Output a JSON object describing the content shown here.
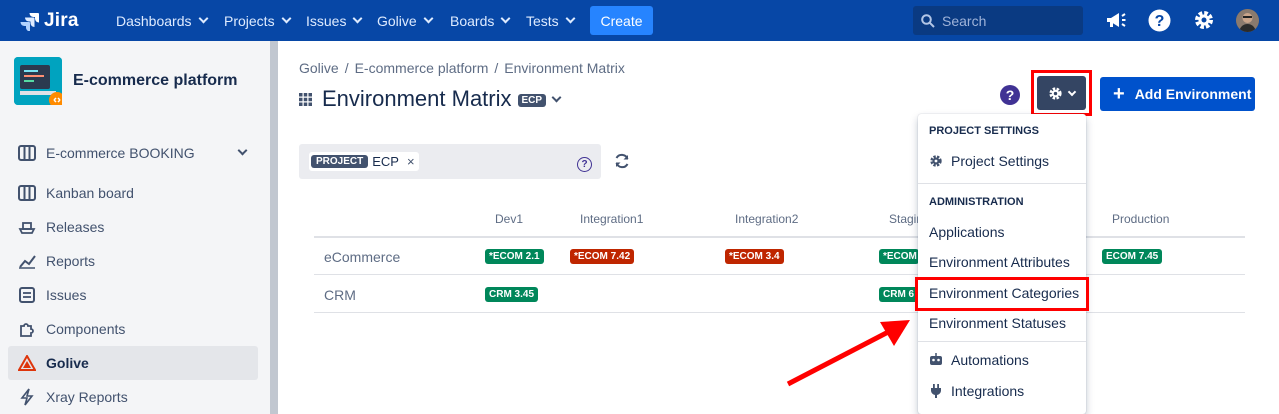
{
  "topbar": {
    "logo_text": "Jira",
    "nav": [
      "Dashboards",
      "Projects",
      "Issues",
      "Golive",
      "Boards",
      "Tests"
    ],
    "create_label": "Create",
    "search_placeholder": "Search",
    "colors": {
      "bar": "#0747a6",
      "create": "#2684ff"
    }
  },
  "sidebar": {
    "project_name": "E-commerce platform",
    "items": [
      {
        "label": "E-commerce BOOKING",
        "icon": "board-icon"
      },
      {
        "label": "Kanban board",
        "icon": "kanban-icon"
      },
      {
        "label": "Releases",
        "icon": "ship-icon"
      },
      {
        "label": "Reports",
        "icon": "chart-icon"
      },
      {
        "label": "Issues",
        "icon": "issues-icon"
      },
      {
        "label": "Components",
        "icon": "puzzle-icon"
      },
      {
        "label": "Golive",
        "icon": "golive-icon"
      },
      {
        "label": "Xray Reports",
        "icon": "bolt-icon"
      }
    ]
  },
  "main": {
    "breadcrumb": [
      "Golive",
      "/",
      "E-commerce platform",
      "/",
      "Environment Matrix"
    ],
    "title": "Environment Matrix",
    "project_key": "ECP",
    "add_button": "Add Environment",
    "filter": {
      "chip_label": "PROJECT",
      "chip_value": "ECP",
      "remove": "×"
    },
    "columns": [
      "Dev1",
      "Integration1",
      "Integration2",
      "Stagir",
      "Production"
    ],
    "rows": [
      {
        "label": "eCommerce",
        "cells": [
          "*ECOM 2.1",
          "*ECOM 7.42",
          "*ECOM 3.4",
          "*ECOM",
          "ECOM 7.45"
        ]
      },
      {
        "label": "CRM",
        "cells": [
          "CRM 3.45",
          "CRM 6"
        ]
      }
    ]
  },
  "dropdown": {
    "project_settings_heading": "PROJECT SETTINGS",
    "project_settings_item": "Project Settings",
    "administration_heading": "ADMINISTRATION",
    "admin_items": [
      "Applications",
      "Environment Attributes",
      "Environment Categories",
      "Environment Statuses"
    ],
    "automations": "Automations",
    "integrations": "Integrations"
  },
  "annotation_color": "#ff0000"
}
